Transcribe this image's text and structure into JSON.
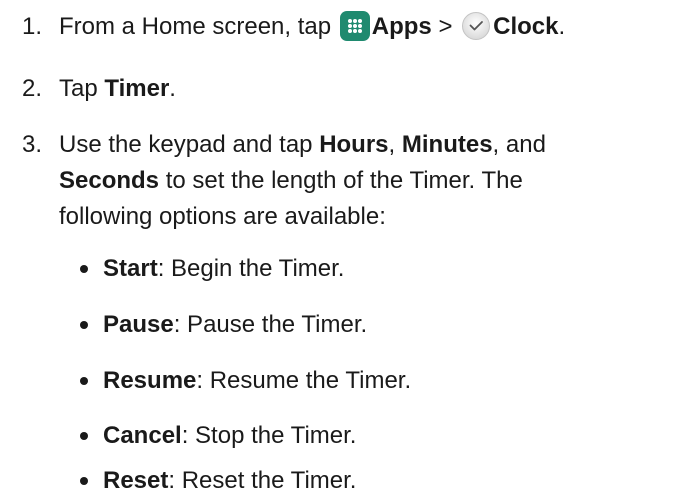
{
  "steps": [
    {
      "number": "1.",
      "prefix": "From a Home screen, tap",
      "apps_label": "Apps",
      "separator": ">",
      "clock_label": "Clock",
      "suffix": "."
    },
    {
      "number": "2.",
      "prefix": "Tap",
      "bold": "Timer",
      "suffix": "."
    },
    {
      "number": "3.",
      "line1_prefix": "Use the keypad and tap",
      "hours": "Hours",
      "comma1": ",",
      "minutes": "Minutes",
      "comma2": ", and",
      "seconds": "Seconds",
      "line2_suffix": "to set the length of the Timer. The",
      "line3": "following options are available:"
    }
  ],
  "options": [
    {
      "label": "Start",
      "description": ": Begin the Timer."
    },
    {
      "label": "Pause",
      "description": ": Pause the Timer."
    },
    {
      "label": "Resume",
      "description": ": Resume the Timer."
    },
    {
      "label": "Cancel",
      "description": ": Stop the Timer."
    },
    {
      "label": "Reset",
      "description": ": Reset the Timer."
    }
  ],
  "icons": {
    "apps": "apps-grid-icon",
    "clock": "clock-icon"
  },
  "colors": {
    "text": "#1a1a1a",
    "apps_icon_bg": "#1f8a6f"
  }
}
